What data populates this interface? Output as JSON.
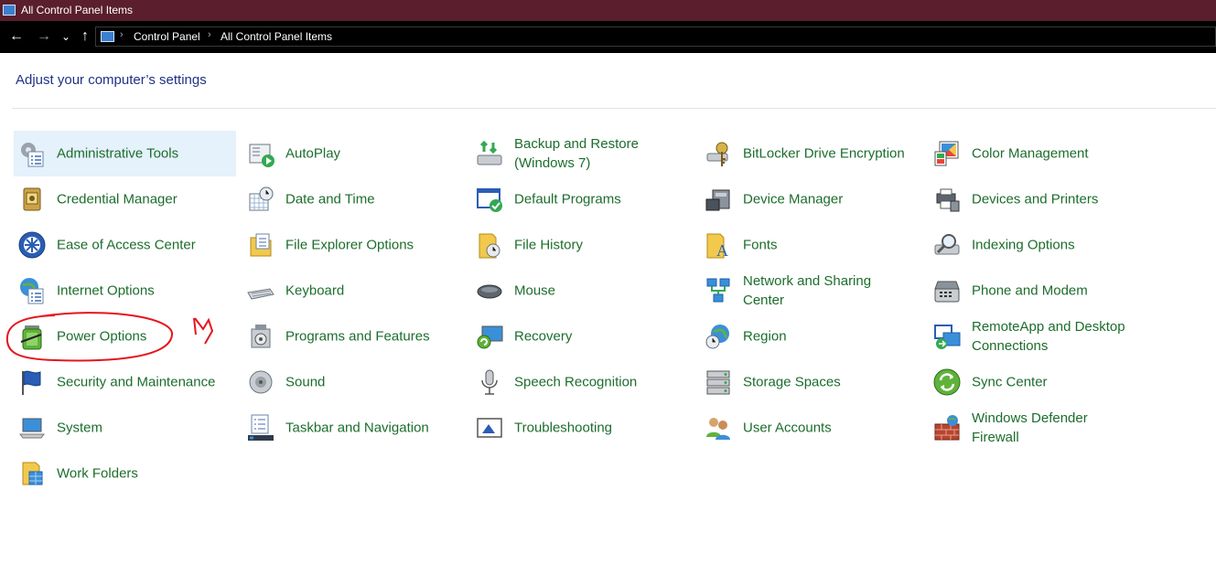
{
  "window": {
    "title": "All Control Panel Items"
  },
  "nav": {
    "back_icon": "←",
    "forward_icon": "→",
    "recent_icon": "⌄",
    "up_icon": "↑"
  },
  "address": {
    "crumbs": [
      "Control Panel",
      "All Control Panel Items"
    ],
    "separator": "›"
  },
  "heading": "Adjust your computer’s settings",
  "items": {
    "administrative_tools": "Administrative Tools",
    "autoplay": "AutoPlay",
    "backup_restore": "Backup and Restore (Windows 7)",
    "bitlocker": "BitLocker Drive Encryption",
    "color_management": "Color Management",
    "credential_manager": "Credential Manager",
    "date_time": "Date and Time",
    "default_programs": "Default Programs",
    "device_manager": "Device Manager",
    "devices_printers": "Devices and Printers",
    "ease_of_access": "Ease of Access Center",
    "file_explorer_options": "File Explorer Options",
    "file_history": "File History",
    "fonts": "Fonts",
    "indexing_options": "Indexing Options",
    "internet_options": "Internet Options",
    "keyboard": "Keyboard",
    "mouse": "Mouse",
    "network_sharing": "Network and Sharing Center",
    "phone_modem": "Phone and Modem",
    "power_options": "Power Options",
    "programs_features": "Programs and Features",
    "recovery": "Recovery",
    "region": "Region",
    "remoteapp": "RemoteApp and Desktop Connections",
    "security_maintenance": "Security and Maintenance",
    "sound": "Sound",
    "speech_recognition": "Speech Recognition",
    "storage_spaces": "Storage Spaces",
    "sync_center": "Sync Center",
    "system": "System",
    "taskbar_navigation": "Taskbar and Navigation",
    "troubleshooting": "Troubleshooting",
    "user_accounts": "User Accounts",
    "windows_defender_firewall": "Windows Defender Firewall",
    "work_folders": "Work Folders"
  },
  "colors": {
    "titlebar": "#5a1e2c",
    "link_green": "#1c6d2c",
    "heading_blue": "#1e3287",
    "selection": "#e5f1fb",
    "annotation": "#e8141c"
  }
}
